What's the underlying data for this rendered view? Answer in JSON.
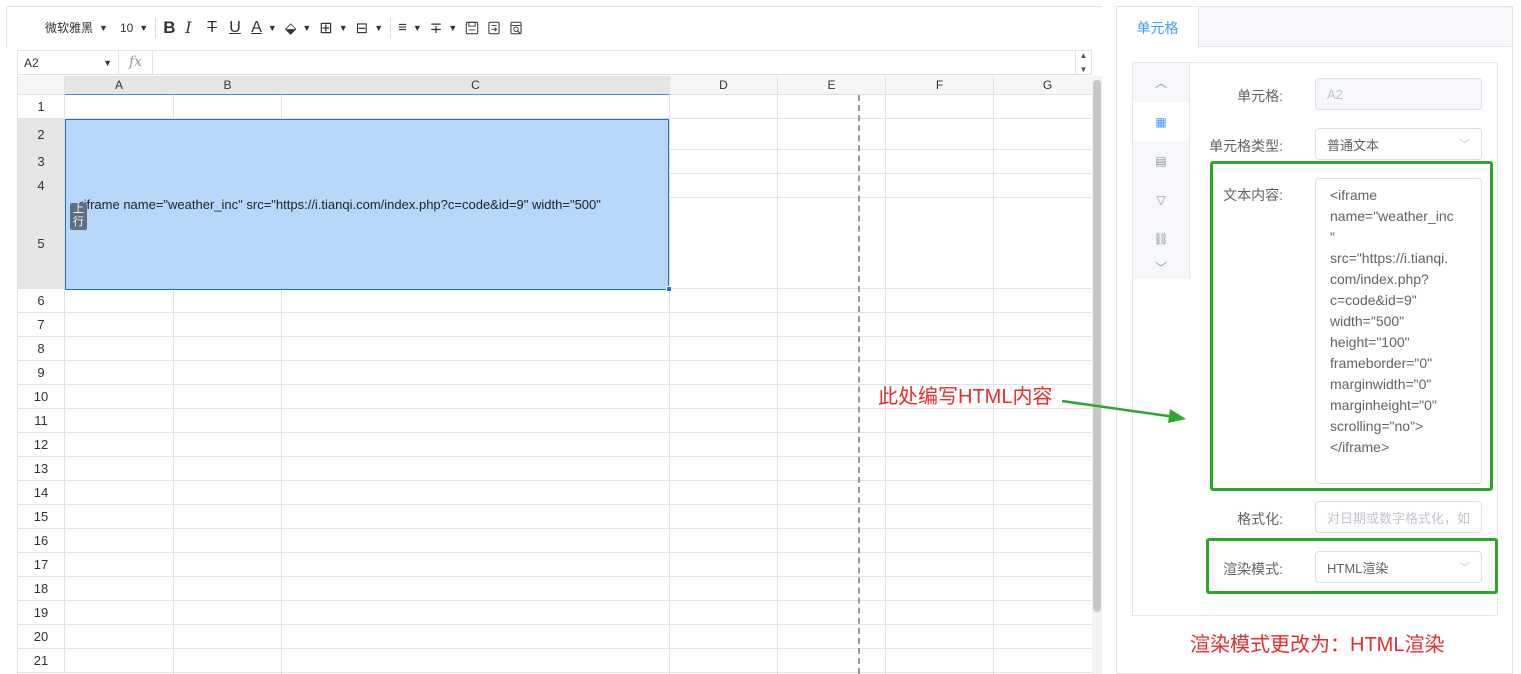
{
  "toolbar": {
    "font_family": "微软雅黑",
    "font_size": "10",
    "bold": "B",
    "italic": "I",
    "strike": "T",
    "underline": "U",
    "font_color": "A"
  },
  "formula_bar": {
    "cell_ref": "A2",
    "fx": "fx"
  },
  "grid": {
    "columns": [
      "A",
      "B",
      "C",
      "D",
      "E",
      "F",
      "G"
    ],
    "rows": [
      "1",
      "2",
      "3",
      "4",
      "5",
      "6",
      "7",
      "8",
      "9",
      "10",
      "11",
      "12",
      "13",
      "14",
      "15",
      "16",
      "17",
      "18",
      "19",
      "20",
      "21"
    ],
    "cell_text": "<iframe name=\"weather_inc\" src=\"https://i.tianqi.com/index.php?c=code&id=9\" width=\"500\"",
    "row_badge": "上\n行"
  },
  "panel": {
    "tab_label": "单元格",
    "cell_label": "单元格:",
    "cell_value": "A2",
    "type_label": "单元格类型:",
    "type_value": "普通文本",
    "text_label": "文本内容:",
    "text_value": "<iframe\nname=\"weather_inc\n\"\nsrc=\"https://i.tianqi.\ncom/index.php?\nc=code&id=9\"\nwidth=\"500\"\nheight=\"100\"\nframeborder=\"0\"\nmarginwidth=\"0\"\nmarginheight=\"0\"\nscrolling=\"no\">\n</iframe>",
    "format_label": "格式化:",
    "format_placeholder": "对日期或数字格式化，如",
    "render_label": "渲染模式:",
    "render_value": "HTML渲染"
  },
  "annotations": {
    "html_note": "此处编写HTML内容",
    "render_note": "渲染模式更改为：HTML渲染"
  },
  "colors": {
    "accent": "#409eff",
    "selection": "#b7d7fa",
    "annotation_red": "#e82c2c",
    "highlight_green": "#2ea62e"
  }
}
